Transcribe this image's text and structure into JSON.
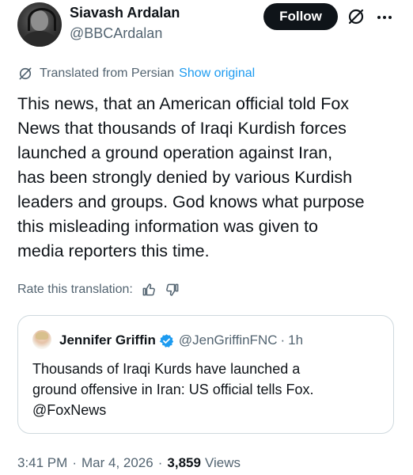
{
  "author": {
    "display_name": "Siavash Ardalan",
    "handle": "@BBCArdalan",
    "follow_label": "Follow"
  },
  "translation": {
    "label": "Translated from Persian",
    "show_original": "Show original",
    "rate_label": "Rate this translation:"
  },
  "tweet": {
    "lines": [
      "This news, that an American official told Fox",
      "News that thousands of Iraqi Kurdish forces",
      "launched a ground operation against Iran,",
      "has been strongly denied by various Kurdish",
      "leaders and groups. God knows what purpose",
      "this misleading information was given to",
      "media reporters this time."
    ]
  },
  "quote": {
    "display_name": "Jennifer Griffin",
    "handle": "@JenGriffinFNC",
    "dot": "·",
    "time": "1h",
    "lines": [
      "Thousands of Iraqi Kurds have launched a",
      "ground offensive in Iran: US official tells Fox.",
      "@FoxNews"
    ]
  },
  "meta": {
    "time": "3:41 PM",
    "dot": "·",
    "date": "Mar 4, 2026",
    "views_count": "3,859",
    "views_label": "Views"
  },
  "icons": {
    "grok": "grok-icon",
    "more": "more-icon",
    "globe": "globe-icon",
    "thumbs_up": "thumbs-up-icon",
    "thumbs_down": "thumbs-down-icon",
    "verified": "verified-badge-icon"
  },
  "colors": {
    "accent": "#1d9bf0",
    "text": "#0f1419",
    "secondary": "#536471",
    "border": "#cfd9de",
    "button_bg": "#0f1419"
  }
}
